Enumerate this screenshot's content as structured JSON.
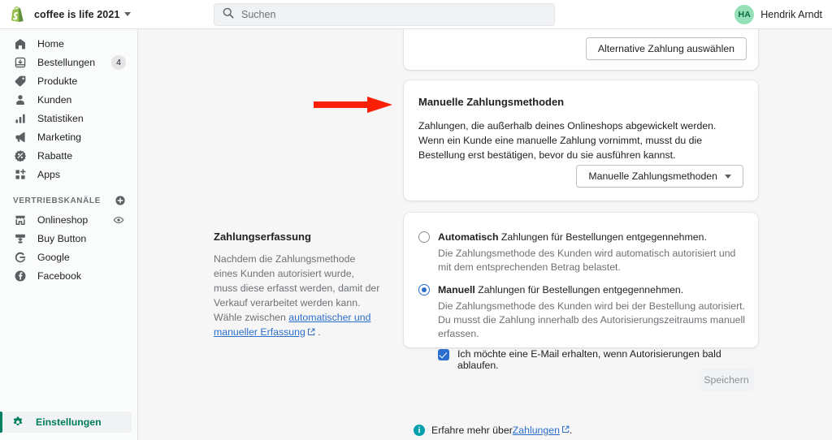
{
  "topbar": {
    "shop_name": "coffee is life 2021",
    "logo_icon": "shopify-bag-icon",
    "shop_caret_icon": "chevron-down-icon",
    "search": {
      "placeholder": "Suchen",
      "icon": "search-icon"
    },
    "user": {
      "initials": "HA",
      "name": "Hendrik Arndt",
      "avatar_bg": "#95e0b6",
      "avatar_fg": "#0b6b44"
    }
  },
  "sidebar": {
    "items": [
      {
        "label": "Home",
        "icon": "home-icon",
        "badge": ""
      },
      {
        "label": "Bestellungen",
        "icon": "orders-inbox-icon",
        "badge": "4"
      },
      {
        "label": "Produkte",
        "icon": "product-tag-icon",
        "badge": ""
      },
      {
        "label": "Kunden",
        "icon": "customer-person-icon",
        "badge": ""
      },
      {
        "label": "Statistiken",
        "icon": "analytics-bars-icon",
        "badge": ""
      },
      {
        "label": "Marketing",
        "icon": "megaphone-icon",
        "badge": ""
      },
      {
        "label": "Rabatte",
        "icon": "discount-percent-icon",
        "badge": ""
      },
      {
        "label": "Apps",
        "icon": "apps-grid-plus-icon",
        "badge": ""
      }
    ],
    "channels_section": {
      "title": "VERTRIEBSKANÄLE",
      "add_icon": "circle-plus-icon",
      "items": [
        {
          "label": "Onlineshop",
          "icon": "storefront-icon",
          "trailing_icon": "eye-icon"
        },
        {
          "label": "Buy Button",
          "icon": "buy-button-icon",
          "trailing_icon": ""
        },
        {
          "label": "Google",
          "icon": "google-g-icon",
          "trailing_icon": ""
        },
        {
          "label": "Facebook",
          "icon": "facebook-f-icon",
          "trailing_icon": ""
        }
      ]
    },
    "settings": {
      "label": "Einstellungen",
      "icon": "gear-icon",
      "accent": "#008060",
      "active": true
    }
  },
  "main": {
    "alternative_payment": {
      "button_label": "Alternative Zahlung auswählen"
    },
    "manual_payments_card": {
      "title": "Manuelle Zahlungsmethoden",
      "body": "Zahlungen, die außerhalb deines Onlineshops abgewickelt werden. Wenn ein Kunde eine manuelle Zahlung vornimmt, musst du die Bestellung erst bestätigen, bevor du sie ausführen kannst.",
      "dropdown_label": "Manuelle Zahlungsmethoden",
      "dropdown_icon": "chevron-down-icon"
    },
    "capture_section": {
      "heading": "Zahlungserfassung",
      "description_before_link": "Nachdem die Zahlungsmethode eines Kunden autorisiert wurde, muss diese erfasst werden, damit der Verkauf verarbeitet werden kann. Wähle zwischen ",
      "link_text": "automatischer und manueller Erfassung",
      "link_icon": "external-link-icon",
      "description_after_link": " .",
      "options": [
        {
          "selected": false,
          "label_bold": "Automatisch",
          "label_rest": " Zahlungen für Bestellungen entgegennehmen.",
          "description": "Die Zahlungsmethode des Kunden wird automatisch autorisiert und mit dem entsprechenden Betrag belastet."
        },
        {
          "selected": true,
          "label_bold": "Manuell",
          "label_rest": " Zahlungen für Bestellungen entgegennehmen.",
          "description": "Die Zahlungsmethode des Kunden wird bei der Bestellung autorisiert. Du musst die Zahlung innerhalb des Autorisierungszeitraums manuell erfassen."
        }
      ],
      "checkbox": {
        "checked": true,
        "label": "Ich möchte eine E-Mail erhalten, wenn Autorisierungen bald ablaufen."
      }
    },
    "save_button": {
      "label": "Speichern",
      "disabled": true
    },
    "footnote": {
      "icon": "info-circle-icon",
      "text_before_link": "Erfahre mehr über ",
      "link_text": "Zahlungen",
      "link_icon": "external-link-icon",
      "text_after_link": " ."
    },
    "annotation": {
      "type": "arrow",
      "color": "#fa1f05",
      "direction": "right"
    }
  }
}
